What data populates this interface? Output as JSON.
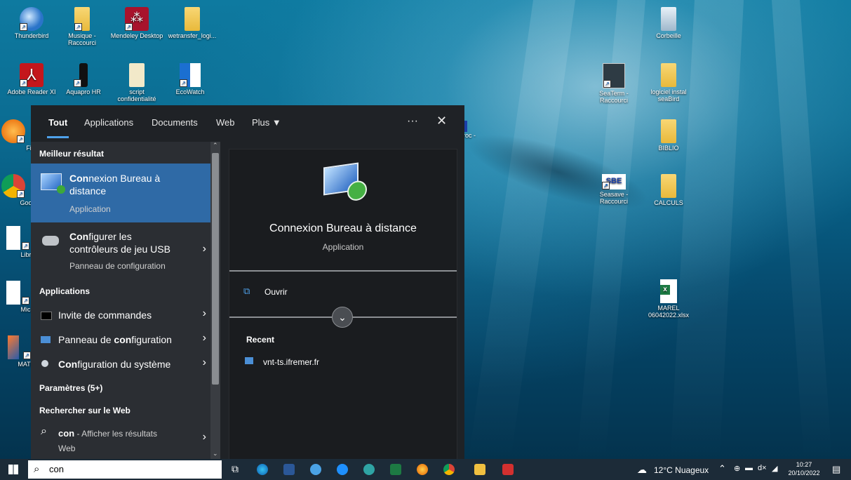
{
  "desktop": {
    "icons": [
      {
        "label": "Thunderbird",
        "name": "thunderbird-icon"
      },
      {
        "label": "Musique - Raccourci",
        "name": "folder-shortcut-icon"
      },
      {
        "label": "Mendeley Desktop",
        "name": "mendeley-icon"
      },
      {
        "label": "wetransfer_logi...",
        "name": "zip-folder-icon"
      },
      {
        "label": "Adobe Reader XI",
        "name": "adobe-reader-icon"
      },
      {
        "label": "Aquapro HR",
        "name": "aquapro-icon"
      },
      {
        "label": "script confidentialité",
        "name": "script-file-icon"
      },
      {
        "label": "EcoWatch",
        "name": "ecowatch-icon"
      },
      {
        "label": "Corbeille",
        "name": "recycle-bin-icon"
      },
      {
        "label": "SeaTerm - Raccourci",
        "name": "seaterm-icon"
      },
      {
        "label": "logiciel instal seaBird",
        "name": "folder-icon"
      },
      {
        "label": "BIBLIO",
        "name": "folder-icon"
      },
      {
        "label": "Seasave - Raccourci",
        "name": "seasave-icon"
      },
      {
        "label": "CALCULS",
        "name": "folder-icon"
      },
      {
        "label": "MAREL 06042022.xlsx",
        "name": "excel-file-icon"
      },
      {
        "label": "Fire",
        "name": "firefox-icon"
      },
      {
        "label": "Google",
        "name": "chrome-icon"
      },
      {
        "label": "LibreO",
        "name": "libreoffice-icon"
      },
      {
        "label": "Microsc",
        "name": "microsoft-icon"
      },
      {
        "label": "MATLAB",
        "name": "matlab-icon"
      },
      {
        "label": "roc -",
        "name": "partial-shortcut-icon"
      }
    ]
  },
  "search": {
    "tabs": [
      "Tout",
      "Applications",
      "Documents",
      "Web",
      "Plus ▼"
    ],
    "more_label": "···",
    "close_label": "✕",
    "best_match_header": "Meilleur résultat",
    "best_match": {
      "title_bold": "Con",
      "title_rest": "nexion Bureau à distance",
      "subtitle": "Application"
    },
    "second": {
      "title_bold": "Con",
      "title_rest": "figurer les contrôleurs de jeu USB",
      "subtitle": "Panneau de configuration"
    },
    "apps_header": "Applications",
    "apps": [
      {
        "pre": "Invite de commandes",
        "bold": "",
        "post": ""
      },
      {
        "pre": "Panneau de ",
        "bold": "con",
        "post": "figuration"
      },
      {
        "pre": "",
        "bold": "Con",
        "post": "figuration du système"
      }
    ],
    "settings_header": "Paramètres (5+)",
    "web_header": "Rechercher sur le Web",
    "web_item": {
      "query": "con",
      "rest": " - Afficher les résultats",
      "sub": "Web"
    },
    "preview": {
      "title": "Connexion Bureau à distance",
      "subtitle": "Application",
      "open_label": "Ouvrir",
      "recent_header": "Recent",
      "recent_items": [
        "vnt-ts.ifremer.fr"
      ]
    },
    "query": "con"
  },
  "taskbar": {
    "weather": "12°C Nuageux",
    "time": "10:27",
    "date": "20/10/2022"
  }
}
